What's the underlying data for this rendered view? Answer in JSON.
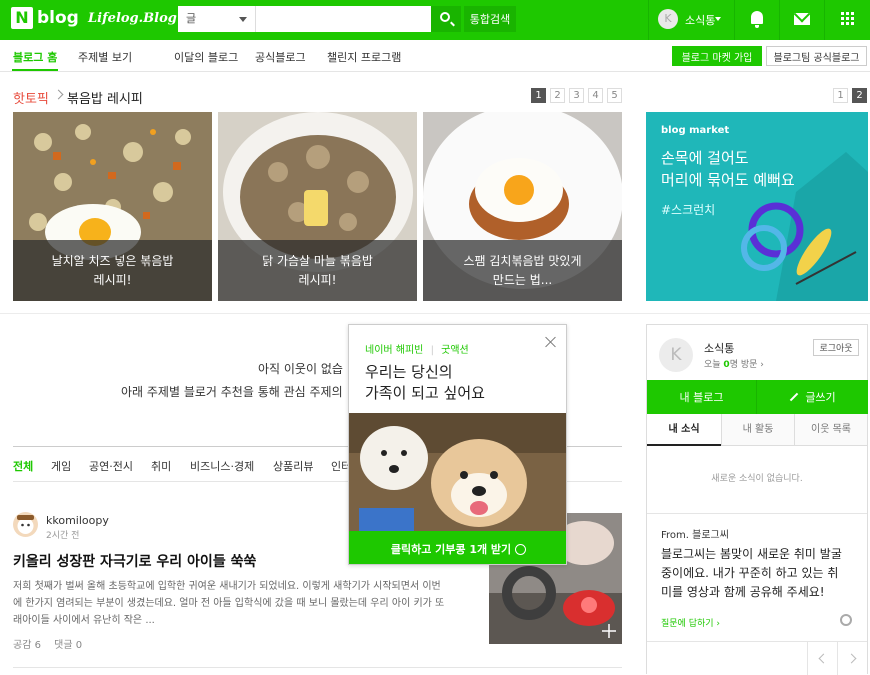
{
  "header": {
    "logo_mark": "N",
    "logo_text": "blog",
    "lifelog_text": "Lifelog.Blog",
    "search_select": "글",
    "search_placeholder": "",
    "integrated_search": "통합검색",
    "user_initial": "K",
    "user_name": "소식통"
  },
  "nav": {
    "items": [
      "블로그 홈",
      "주제별 보기",
      "이달의 블로그",
      "공식블로그",
      "챌린지 프로그램"
    ],
    "market_button": "블로그 마켓 가입",
    "official_button": "블로그팀 공식블로그"
  },
  "hot_topic": {
    "label": "핫토픽",
    "title": "볶음밥 레시피",
    "pages": [
      "1",
      "2",
      "3",
      "4",
      "5"
    ],
    "active_page": "1",
    "cards": [
      {
        "caption_l1": "날치알 치즈 넣은 볶음밥",
        "caption_l2": "레시피!"
      },
      {
        "caption_l1": "닭 가슴살 마늘 볶음밥",
        "caption_l2": "레시피!"
      },
      {
        "caption_l1": "스팸 김치볶음밥 맛있게",
        "caption_l2": "만드는 법..."
      }
    ]
  },
  "market_ad": {
    "pages": [
      "1",
      "2"
    ],
    "active_page": "2",
    "brand": "blog market",
    "line1": "손목에 걸어도",
    "line2": "머리에 묶어도 예뻐요",
    "tag": "#스크런치",
    "bg_color": "#1fb7b9"
  },
  "main": {
    "notice_line1": "아직 이웃이 없습",
    "notice_line2": "아래 주제별 블로거 추천을 통해 관심 주제의",
    "categories": [
      "전체",
      "게임",
      "공연·전시",
      "취미",
      "비즈니스·경제",
      "상품리뷰",
      "인터"
    ],
    "active_category": "전체",
    "post": {
      "author": "kkomiloopy",
      "time": "2시간 전",
      "title": "키올리 성장판 자극기로 우리 아이들 쑥쑥",
      "body_l1": "저희 첫째가 벌써 올해 초등학교에 입학한 귀여운 새내기가 되었네요. 이렇게 새학기가 시작되면서 이번",
      "body_l2": "에 한가지 염려되는 부분이 생겼는데요. 얼마 전 아들 입학식에 갔을 때 보니 몰랐는데 우리 아이 키가 또",
      "body_l3": "래아이들 사이에서 유난히 작은 ...",
      "likes": "공감 6",
      "comments": "댓글 0"
    }
  },
  "popup": {
    "tag_left": "네이버 해피빈",
    "tag_right": "굿액션",
    "headline_l1": "우리는 당신의",
    "headline_l2": "가족이 되고 싶어요",
    "cta": "클릭하고 기부콩 1개 받기"
  },
  "sidebar": {
    "initial": "K",
    "name": "소식통",
    "visit_prefix": "오늘 ",
    "visit_count": "0",
    "visit_suffix": "명 방문",
    "logout": "로그아웃",
    "my_blog": "내 블로그",
    "write": "글쓰기",
    "tabs": [
      "내 소식",
      "내 활동",
      "이웃 목록"
    ],
    "empty_text": "새로운 소식이 없습니다.",
    "from": "From. 블로그씨",
    "message_l1": "블로그씨는 봄맞이 새로운 취미 발굴",
    "message_l2": "중이에요. 내가 꾸준히 하고 있는 취",
    "message_l3": "미를 영상과 함께 공유해 주세요!",
    "reply": "질문에 답하기"
  },
  "colors": {
    "brand": "#1ec800",
    "topic_red": "#e84c3d"
  }
}
